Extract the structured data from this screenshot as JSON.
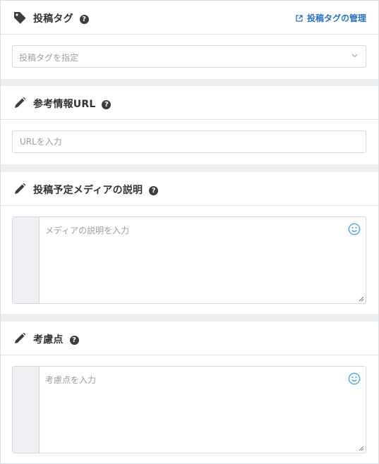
{
  "tags_panel": {
    "title": "投稿タグ",
    "help": "?",
    "manage_link": "投稿タグの管理",
    "select_placeholder": "投稿タグを指定"
  },
  "url_panel": {
    "title": "参考情報URL",
    "help": "?",
    "input_placeholder": "URLを入力"
  },
  "media_panel": {
    "title": "投稿予定メディアの説明",
    "help": "?",
    "textarea_placeholder": "メディアの説明を入力"
  },
  "points_panel": {
    "title": "考慮点",
    "help": "?",
    "textarea_placeholder": "考慮点を入力"
  },
  "colors": {
    "link": "#2a73c2",
    "emoji": "#5aa9e6",
    "background": "#eceef0"
  },
  "icons": [
    "tag-icon",
    "pencil-icon",
    "external-link-icon",
    "chevron-down-icon",
    "smiley-icon",
    "resize-grip-icon"
  ]
}
